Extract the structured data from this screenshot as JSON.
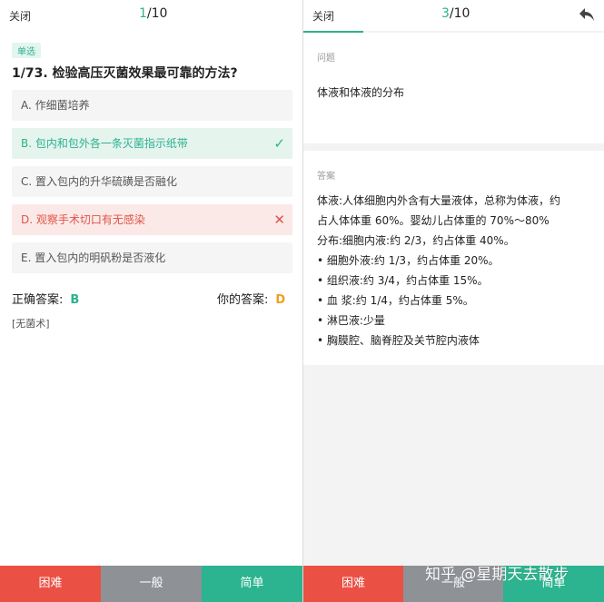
{
  "left": {
    "close_label": "关闭",
    "counter_current": "1",
    "counter_total": "/10",
    "tag": "单选",
    "question_title": "1/73. 检验高压灭菌效果最可靠的方法?",
    "options": [
      {
        "label": "A. 作细菌培养",
        "state": "normal"
      },
      {
        "label": "B. 包内和包外各一条灭菌指示纸带",
        "state": "correct",
        "mark": "✓"
      },
      {
        "label": "C. 置入包内的升华硫磺是否融化",
        "state": "normal"
      },
      {
        "label": "D. 观察手术切口有无感染",
        "state": "wrong",
        "mark": "✕"
      },
      {
        "label": "E. 置入包内的明矾粉是否液化",
        "state": "normal"
      }
    ],
    "correct_answer_label": "正确答案:",
    "correct_answer_value": "B",
    "your_answer_label": "你的答案:",
    "your_answer_value": "D",
    "note": "[无菌术]",
    "buttons": {
      "hard": "困难",
      "normal": "一般",
      "easy": "简单"
    }
  },
  "right": {
    "close_label": "关闭",
    "counter_current": "3",
    "counter_total": "/10",
    "back_icon": "reply-arrow-icon",
    "question_label": "问题",
    "question_text": "体液和体液的分布",
    "answer_label": "答案",
    "answer_lines": [
      "体液:人体细胞内外含有大量液体，总称为体液，约",
      "占人体体重 60%。婴幼儿占体重的 70%～80%",
      "分布:细胞内液:约 2/3，约占体重 40%。",
      "• 细胞外液:约 1/3，约占体重 20%。",
      "• 组织液:约 3/4，约占体重 15%。",
      "• 血 浆:约 1/4，约占体重 5%。",
      "• 淋巴液:少量",
      "• 胸膜腔、脑脊腔及关节腔内液体"
    ],
    "buttons": {
      "hard": "困难",
      "normal": "一般",
      "easy": "简单"
    }
  },
  "watermark": "知乎 @星期天去散步",
  "colors": {
    "accent": "#2bb28f",
    "error": "#e0544a",
    "warning": "#f0a020",
    "hard": "#ea5044",
    "normal": "#8e9196",
    "easy": "#2bb48f"
  }
}
